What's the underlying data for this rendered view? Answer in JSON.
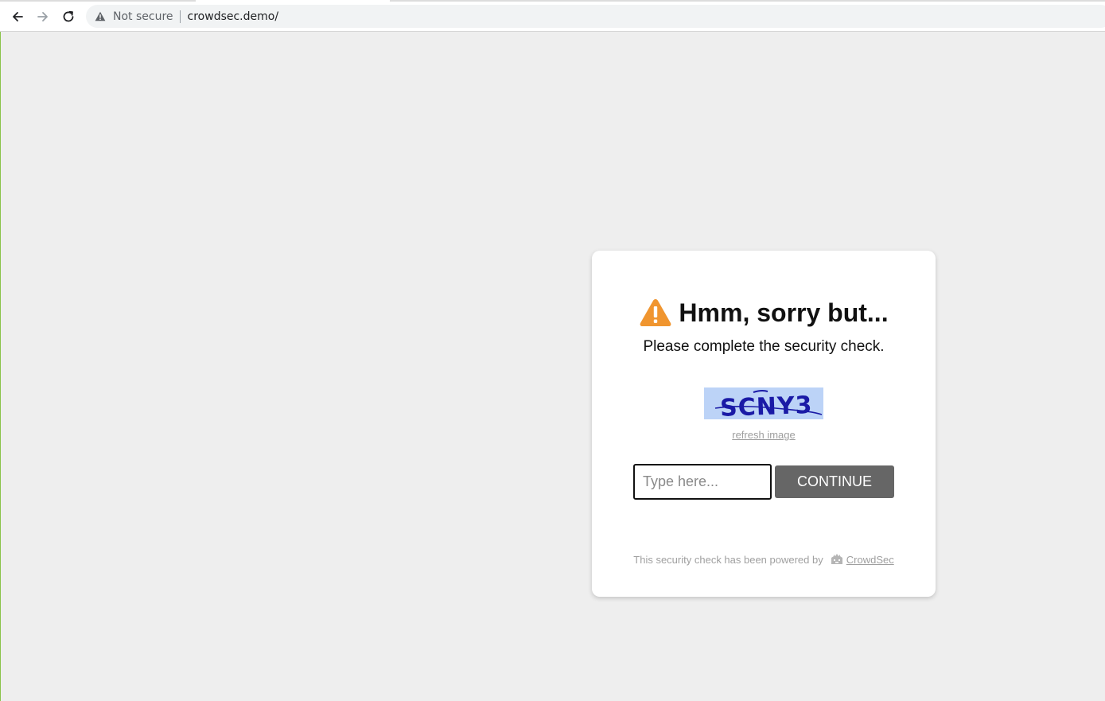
{
  "browser": {
    "security_label": "Not secure",
    "url": "crowdsec.demo/"
  },
  "card": {
    "heading": "Hmm, sorry but...",
    "subtitle": "Please complete the security check.",
    "captcha_text": "SCNY3",
    "refresh_label": "refresh image",
    "input_placeholder": "Type here...",
    "input_value": "",
    "continue_label": "CONTINUE",
    "powered_by": "This security check has been powered by",
    "brand_link": "CrowdSec"
  },
  "colors": {
    "warning": "#f0952f",
    "button": "#666666",
    "captcha_bg": "#bcd3f7",
    "captcha_ink": "#1a1aa6"
  },
  "icons": {
    "back": "arrow-left-icon",
    "forward": "arrow-right-icon",
    "reload": "reload-icon",
    "security": "warning-triangle-icon",
    "heading": "warning-triangle-icon",
    "brand": "crowdsec-logo-icon"
  }
}
